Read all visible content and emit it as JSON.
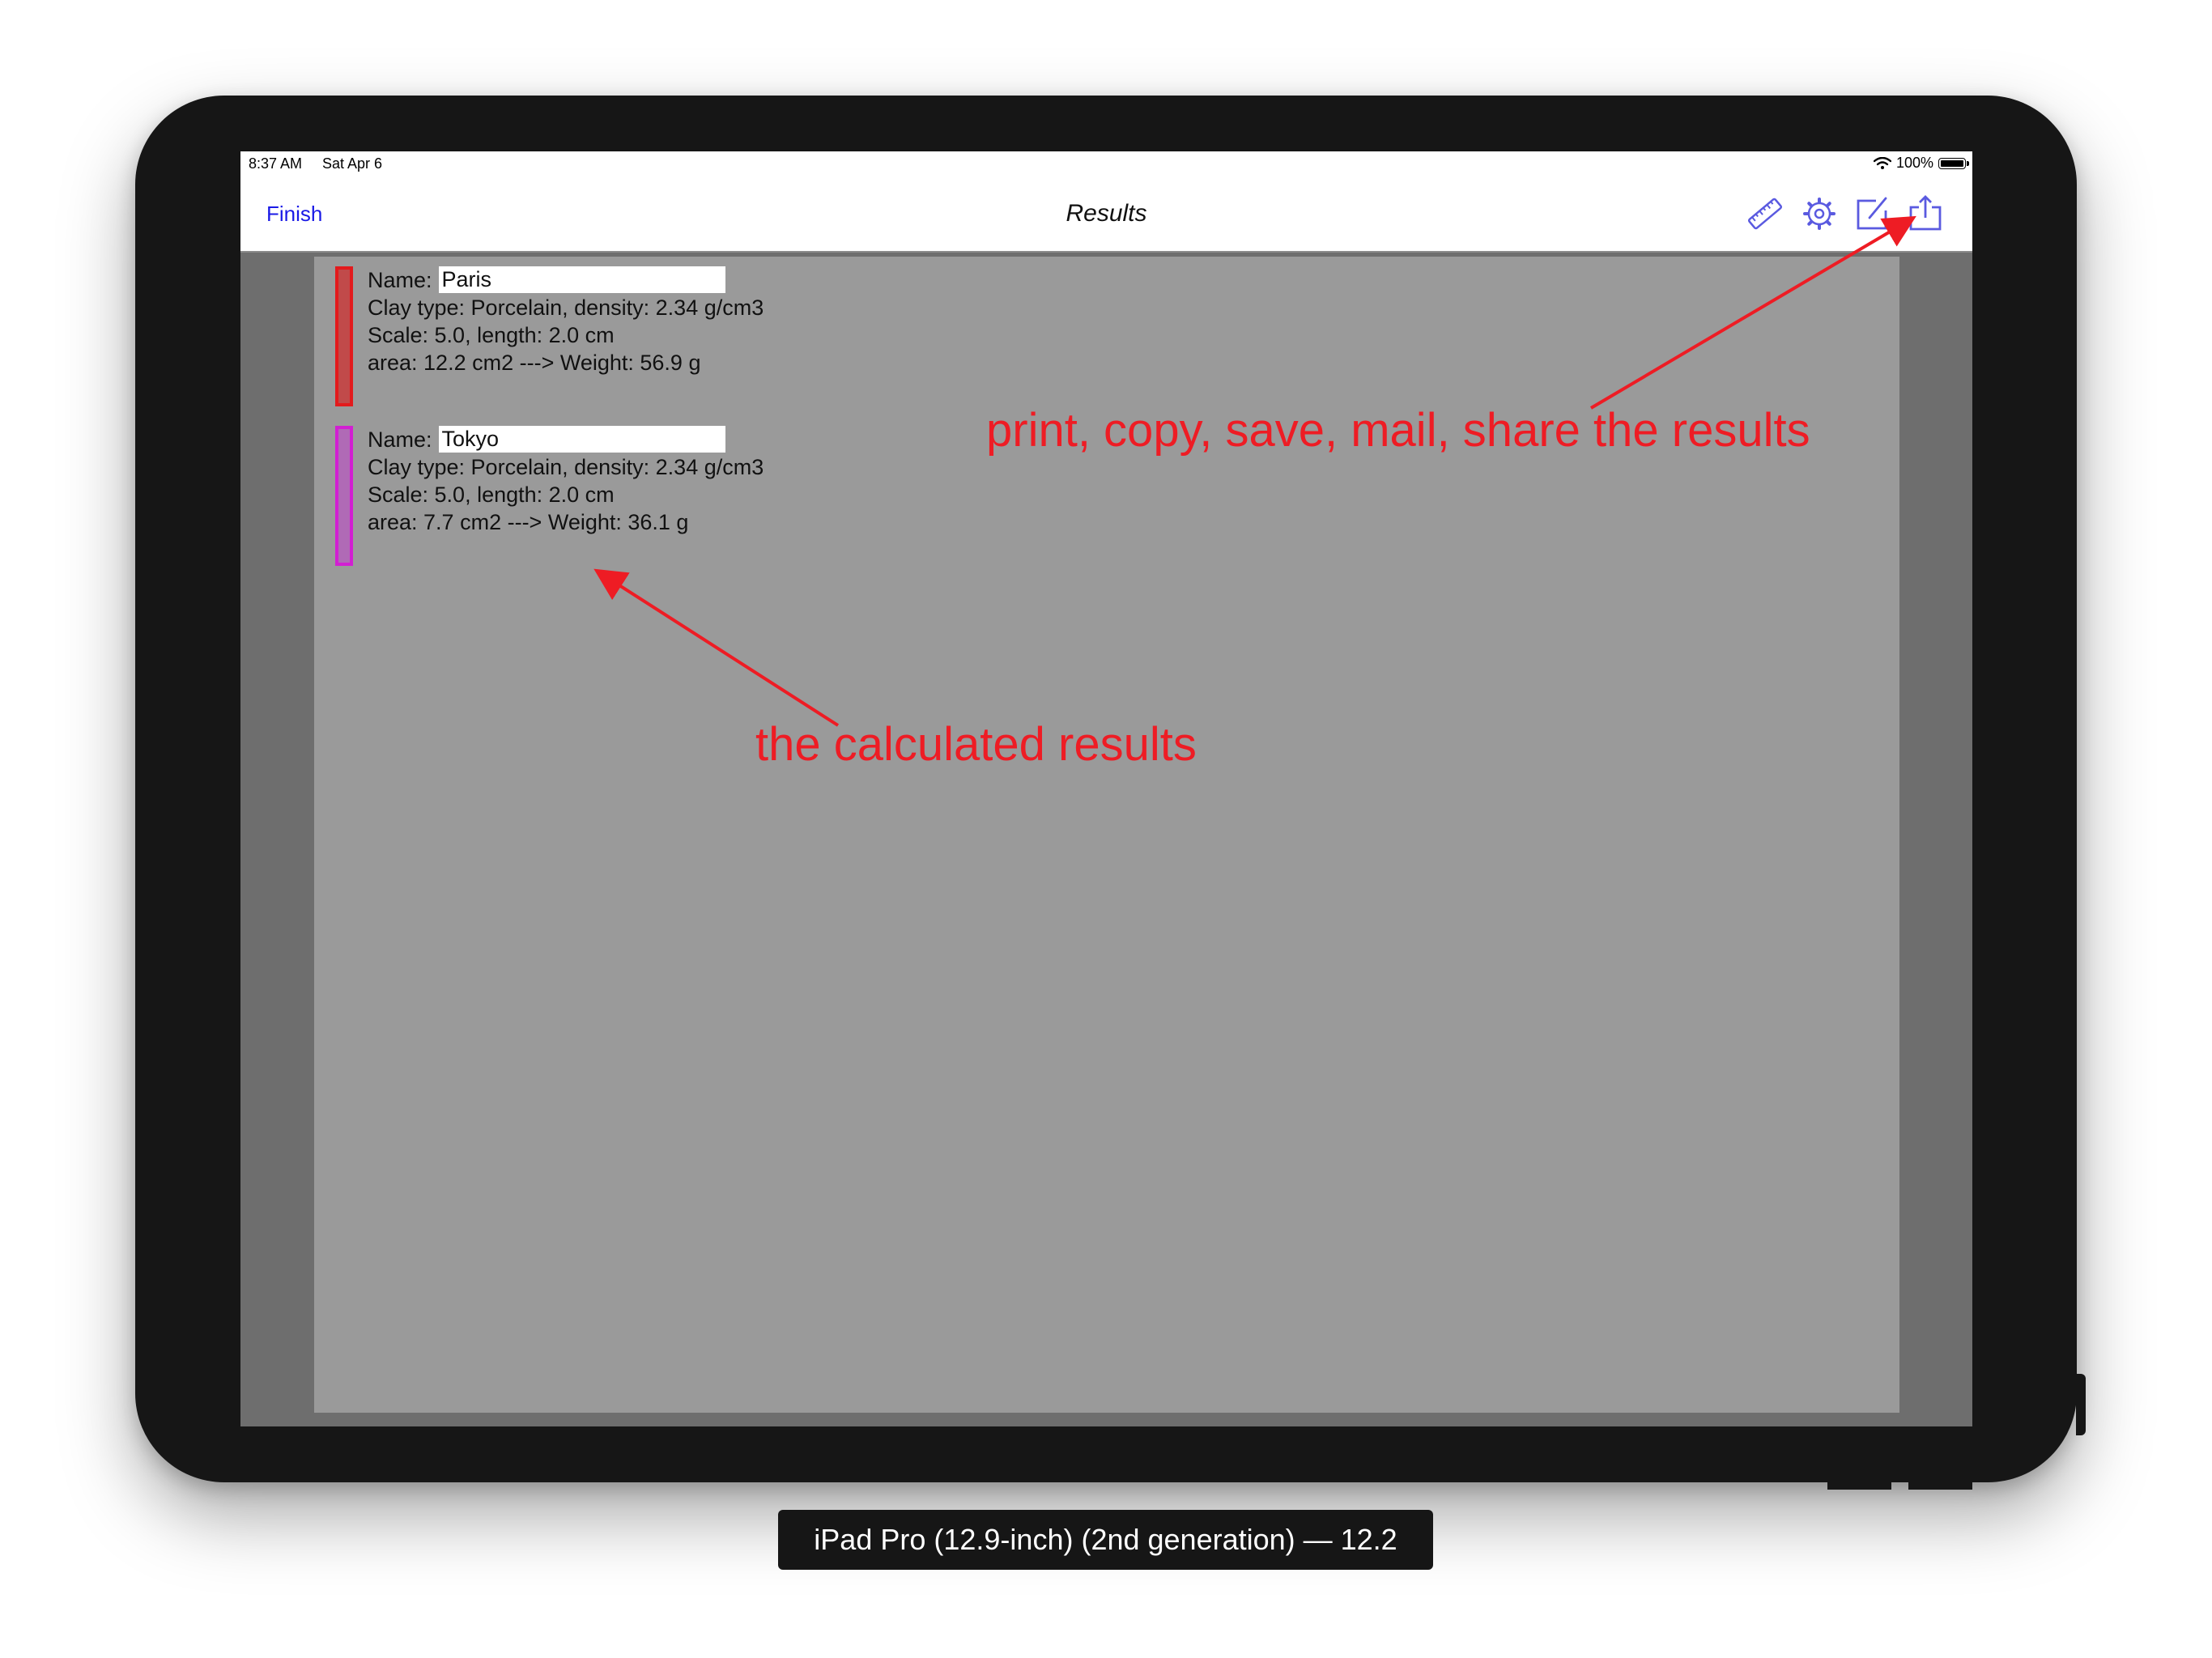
{
  "status_bar": {
    "time": "8:37 AM",
    "date": "Sat Apr 6",
    "battery": "100%"
  },
  "navbar": {
    "finish_label": "Finish",
    "title": "Results",
    "icons": [
      "ruler-icon",
      "gear-icon",
      "compose-icon",
      "share-icon"
    ]
  },
  "results": [
    {
      "name_label": "Name:",
      "name": "Paris",
      "clay_line": "Clay type: Porcelain, density: 2.34 g/cm3",
      "scale_line": "Scale: 5.0, length: 2.0 cm",
      "area_line": "area: 12.2 cm2 ---> Weight: 56.9 g",
      "color": "#e31a1c"
    },
    {
      "name_label": "Name:",
      "name": "Tokyo",
      "clay_line": "Clay type: Porcelain, density: 2.34 g/cm3",
      "scale_line": "Scale: 5.0, length: 2.0 cm",
      "area_line": "area: 7.7 cm2 ---> Weight: 36.1 g",
      "color": "#d21fd2"
    }
  ],
  "annotations": {
    "share": "print, copy, save, mail, share the results",
    "results": "the calculated results",
    "color": "#ee1c24"
  },
  "device_caption": "iPad Pro (12.9-inch) (2nd generation) — 12.2",
  "colors": {
    "accent": "#1a1ae6",
    "icon": "#5a5ae0"
  }
}
